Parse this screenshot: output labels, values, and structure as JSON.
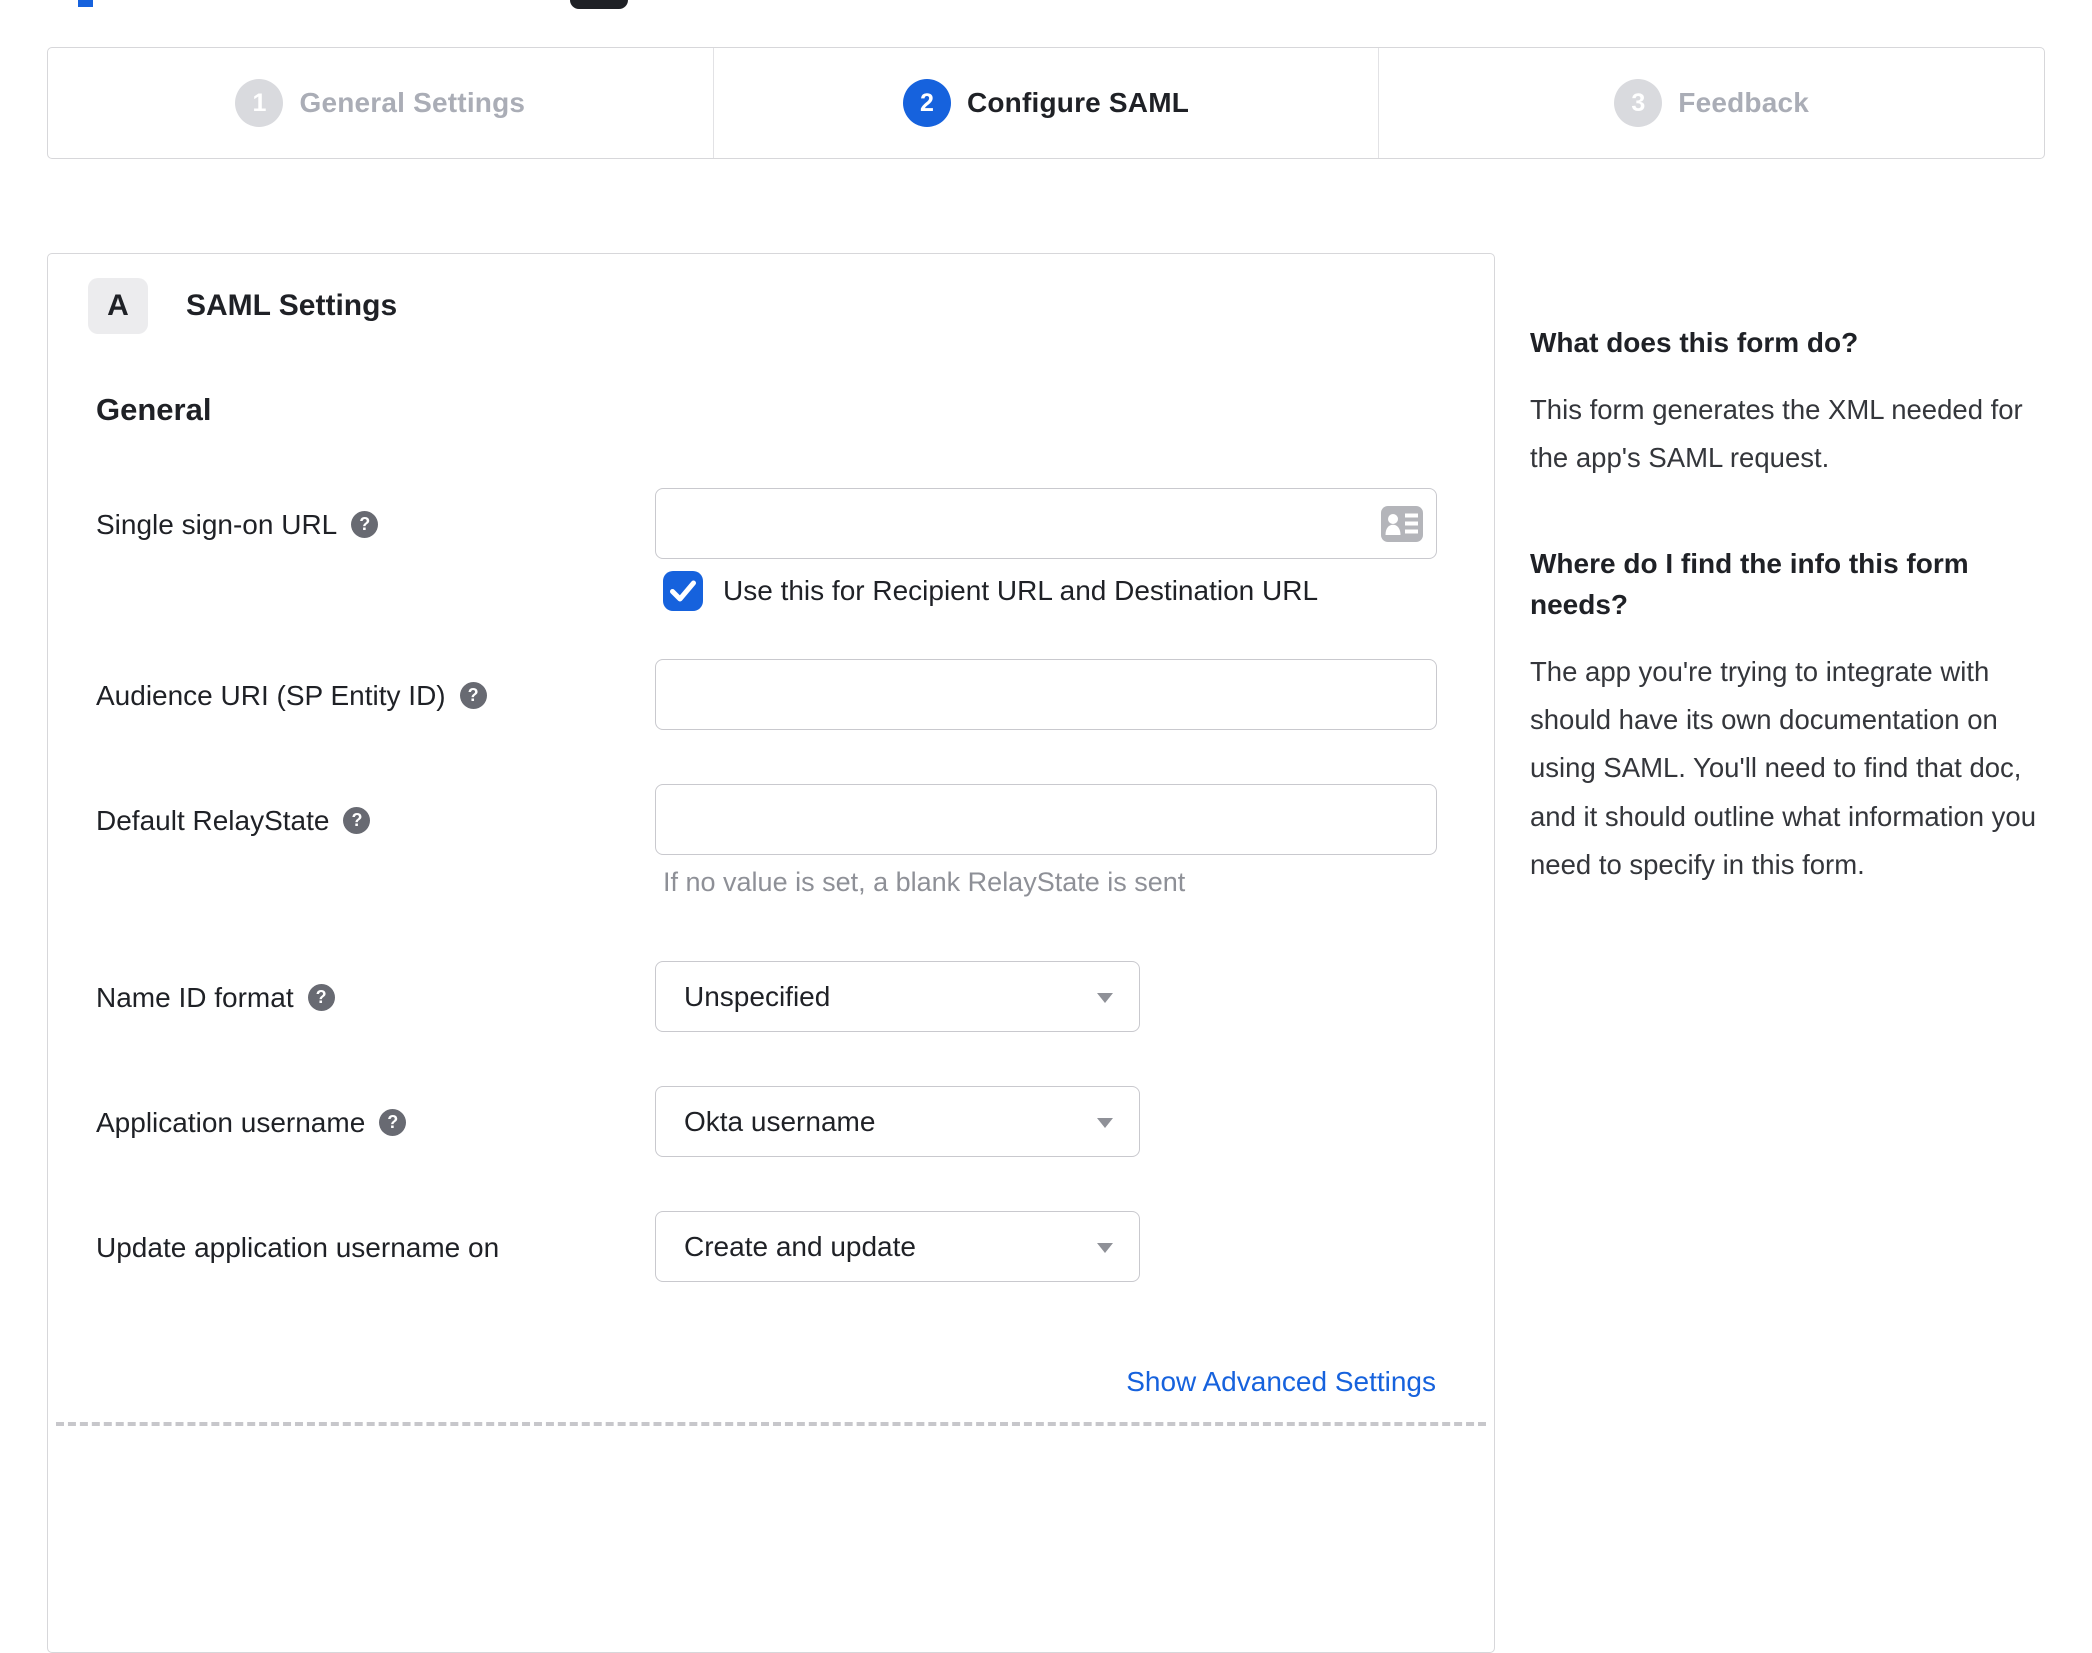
{
  "stepper": {
    "steps": [
      {
        "number": "1",
        "label": "General Settings",
        "state": "inactive"
      },
      {
        "number": "2",
        "label": "Configure SAML",
        "state": "active"
      },
      {
        "number": "3",
        "label": "Feedback",
        "state": "inactive"
      }
    ]
  },
  "panel": {
    "badge": "A",
    "title": "SAML Settings",
    "section_title": "General",
    "fields": {
      "sso_url": {
        "label": "Single sign-on URL",
        "value": "",
        "has_help": true,
        "icon": "contact-card"
      },
      "sso_checkbox": {
        "label": "Use this for Recipient URL and Destination URL",
        "checked": true
      },
      "audience_uri": {
        "label": "Audience URI (SP Entity ID)",
        "value": "",
        "has_help": true
      },
      "default_relaystate": {
        "label": "Default RelayState",
        "value": "",
        "has_help": true,
        "hint": "If no value is set, a blank RelayState is sent"
      },
      "name_id_format": {
        "label": "Name ID format",
        "value": "Unspecified",
        "has_help": true
      },
      "application_username": {
        "label": "Application username",
        "value": "Okta username",
        "has_help": true
      },
      "update_app_username_on": {
        "label": "Update application username on",
        "value": "Create and update",
        "has_help": false
      }
    },
    "help_icon_glyph": "?",
    "advanced_link": "Show Advanced Settings"
  },
  "sidebar": {
    "sections": [
      {
        "heading": "What does this form do?",
        "body": "This form generates the XML needed for the app's SAML request."
      },
      {
        "heading": "Where do I find the info this form needs?",
        "body": "The app you're trying to integrate with should have its own documentation on using SAML. You'll need to find that doc, and it should outline what information you need to specify in this form."
      }
    ]
  },
  "colors": {
    "accent_blue": "#1662dd",
    "inactive_circle": "#d9dade",
    "inactive_text": "#aaadb6",
    "text_dark": "#1f2126",
    "panel_border": "#d7d7da",
    "input_border": "#c9c9ce",
    "hint_text": "#8e9097",
    "help_icon_bg": "#686a72",
    "field_icon_gray": "#b4b5ba"
  }
}
